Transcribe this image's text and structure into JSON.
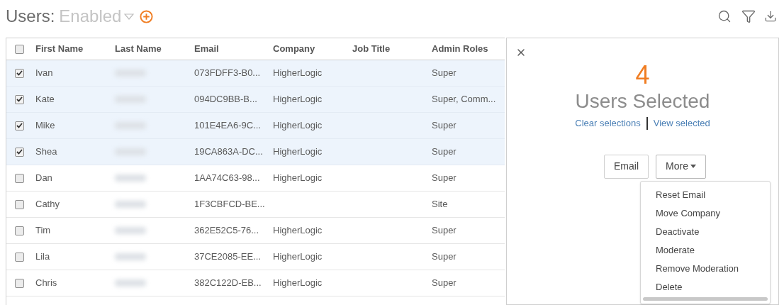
{
  "header": {
    "title": "Users:",
    "filter": "Enabled"
  },
  "table": {
    "columns": [
      "First Name",
      "Last Name",
      "Email",
      "Company",
      "Job Title",
      "Admin Roles"
    ],
    "all_checked": false,
    "rows": [
      {
        "checked": true,
        "selected": true,
        "first_name": "Ivan",
        "email": "073FDFF3-B0...",
        "company": "HigherLogic",
        "admin_roles": "Super"
      },
      {
        "checked": true,
        "selected": true,
        "first_name": "Kate",
        "email": "094DC9BB-B...",
        "company": "HigherLogic",
        "admin_roles": "Super, Comm..."
      },
      {
        "checked": true,
        "selected": true,
        "first_name": "Mike",
        "email": "101E4EA6-9C...",
        "company": "HigherLogic",
        "admin_roles": "Super"
      },
      {
        "checked": true,
        "selected": true,
        "first_name": "Shea",
        "email": "19CA863A-DC...",
        "company": "HigherLogic",
        "admin_roles": "Super"
      },
      {
        "checked": false,
        "selected": false,
        "first_name": "Dan",
        "email": "1AA74C63-98...",
        "company": "HigherLogic",
        "admin_roles": "Super"
      },
      {
        "checked": false,
        "selected": false,
        "first_name": "Cathy",
        "email": "1F3CBFCD-BE...",
        "admin_roles": "Site"
      },
      {
        "checked": false,
        "selected": false,
        "first_name": "Tim",
        "email": "362E52C5-76...",
        "company": "HigherLogic",
        "admin_roles": "Super"
      },
      {
        "checked": false,
        "selected": false,
        "first_name": "Lila",
        "email": "37CE2085-EE...",
        "company": "HigherLogic",
        "admin_roles": "Super"
      },
      {
        "checked": false,
        "selected": false,
        "first_name": "Chris",
        "email": "382C122D-EB...",
        "company": "HigherLogic",
        "admin_roles": "Super"
      }
    ]
  },
  "selection_panel": {
    "count": "4",
    "label": "Users Selected",
    "links": [
      "Clear selections",
      "View selected"
    ],
    "buttons": [
      "Email",
      "More"
    ],
    "menu": {
      "expanded": true,
      "items": [
        "Reset Email",
        "Move Company",
        "Deactivate",
        "Moderate",
        "Remove Moderation",
        "Delete"
      ]
    }
  }
}
